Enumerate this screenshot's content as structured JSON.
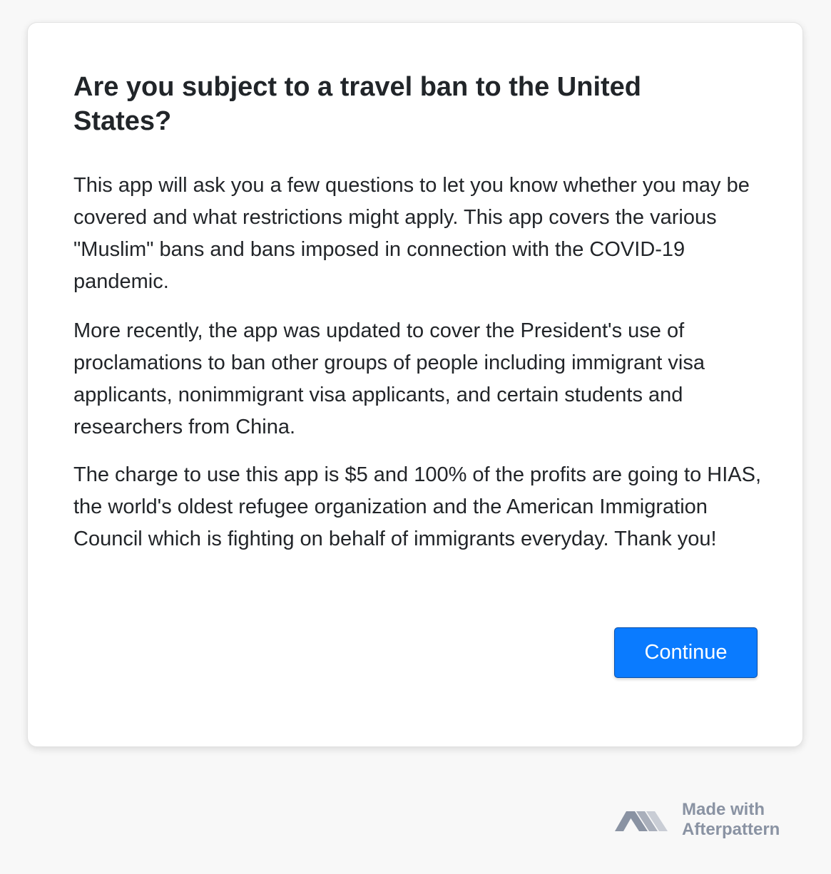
{
  "intro": {
    "title": "Are you subject to a travel ban to the United States?",
    "paragraphs": [
      "This app will ask you a few questions to let you know whether you may be covered and what restrictions might apply. This app covers the various \"Muslim\" bans and bans imposed in connection with the COVID-19 pandemic.",
      "More recently, the app was updated to cover the President's use of proclamations to ban other groups of people including immigrant visa applicants, nonimmigrant visa applicants, and certain students and researchers from China.",
      "The charge to use this app is $5 and 100% of the profits are going to HIAS, the world's oldest refugee organization and the American Immigration Council which is fighting on behalf of immigrants everyday. Thank you!"
    ],
    "continue_label": "Continue"
  },
  "footer": {
    "made_with": "Made with",
    "brand_name": "Afterpattern",
    "logo_icon": "afterpattern-logo-icon"
  },
  "colors": {
    "page_background": "#f8f8f8",
    "card_background": "#ffffff",
    "button_primary": "#0a7bff",
    "text": "#222529",
    "footer_text": "#8a93a3"
  }
}
